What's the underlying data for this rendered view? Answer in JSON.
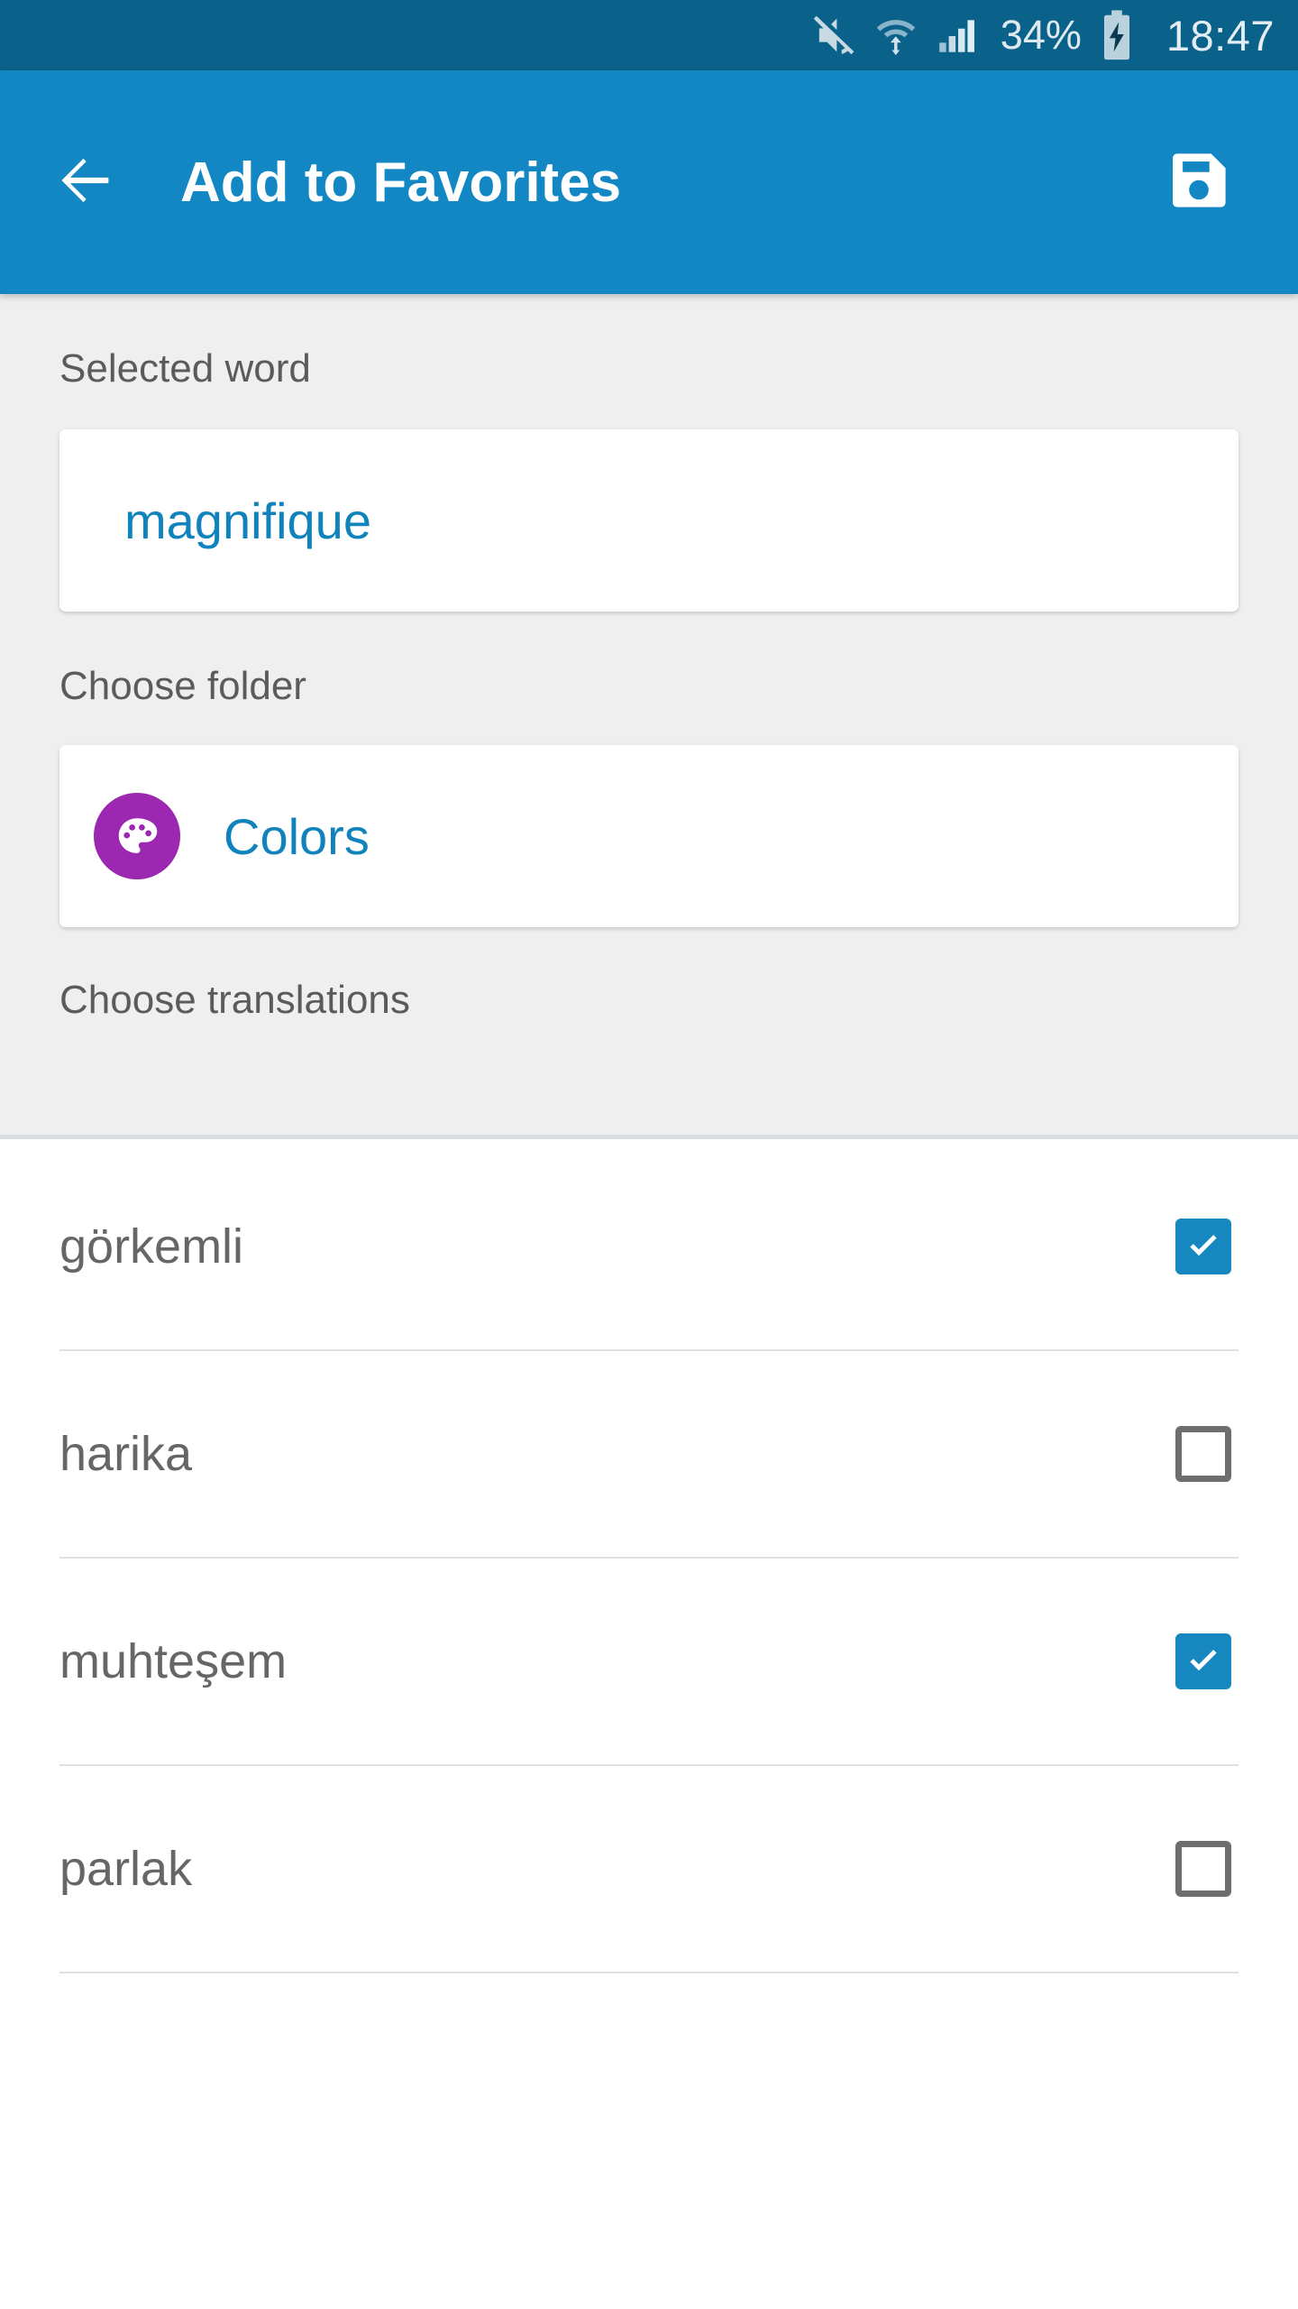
{
  "status_bar": {
    "battery_percent": "34%",
    "time": "18:47",
    "icons": [
      "mute-icon",
      "wifi-icon",
      "signal-icon",
      "battery-charging-icon"
    ],
    "background_color": "#0a6189",
    "text_color": "#dfeaf0"
  },
  "app_bar": {
    "title": "Add to Favorites",
    "back_icon": "arrow-left-icon",
    "save_icon": "floppy-disk-save-icon",
    "background_color": "#1287c4",
    "title_color": "#ffffff"
  },
  "form": {
    "selected_word_label": "Selected word",
    "selected_word_value": "magnifique",
    "choose_folder_label": "Choose folder",
    "folder_name": "Colors",
    "folder_icon": "palette-icon",
    "folder_icon_color": "#9c27b0",
    "choose_translations_label": "Choose translations",
    "value_color": "#1083bd",
    "label_color": "#5b5b5b",
    "section_background": "#efefef"
  },
  "translations": [
    {
      "text": "görkemli",
      "checked": true
    },
    {
      "text": "harika",
      "checked": false
    },
    {
      "text": "muhteşem",
      "checked": true
    },
    {
      "text": "parlak",
      "checked": false
    }
  ],
  "theme": {
    "checkbox_checked_color": "#1787c0",
    "checkbox_unchecked_border": "#6e6e6e",
    "list_text_color": "#666666",
    "divider_color": "#e0e0e0"
  }
}
